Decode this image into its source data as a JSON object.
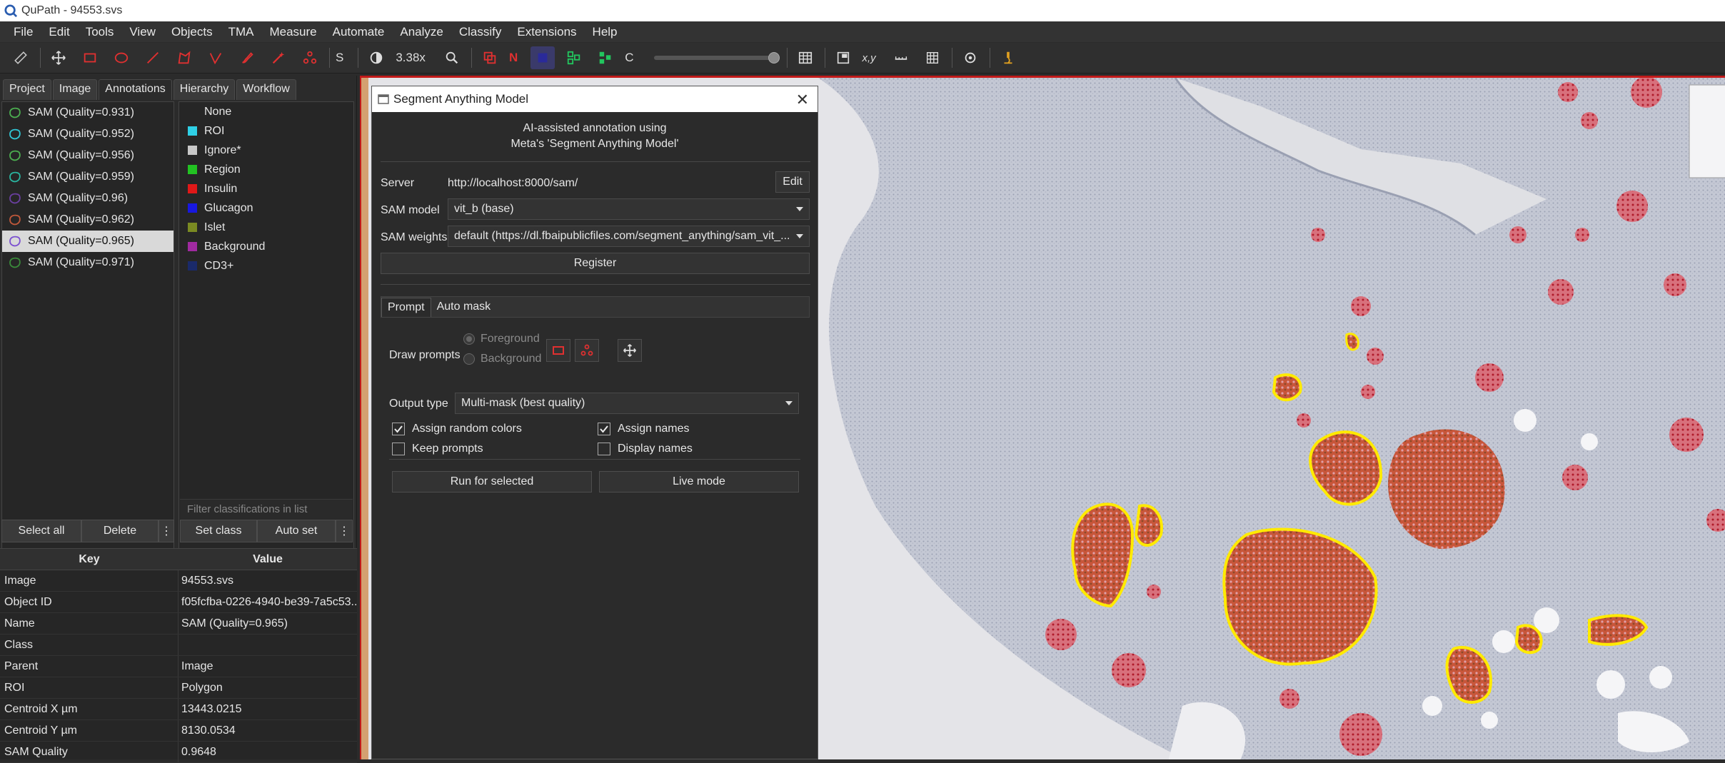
{
  "window": {
    "title": "QuPath - 94553.svs"
  },
  "menu": [
    "File",
    "Edit",
    "Tools",
    "View",
    "Objects",
    "TMA",
    "Measure",
    "Automate",
    "Analyze",
    "Classify",
    "Extensions",
    "Help"
  ],
  "toolbar": {
    "zoom": "3.38x",
    "s_label": "S",
    "n_label": "N",
    "c_label": "C",
    "xy_label": "x,y"
  },
  "left_tabs": [
    "Project",
    "Image",
    "Annotations",
    "Hierarchy",
    "Workflow"
  ],
  "annotations": [
    {
      "name": "SAM (Quality=0.931)",
      "color": "#4caf50"
    },
    {
      "name": "SAM (Quality=0.952)",
      "color": "#31c7d6"
    },
    {
      "name": "SAM (Quality=0.956)",
      "color": "#4caf50"
    },
    {
      "name": "SAM (Quality=0.959)",
      "color": "#2ab5a0"
    },
    {
      "name": "SAM (Quality=0.96)",
      "color": "#6a3fa0"
    },
    {
      "name": "SAM (Quality=0.962)",
      "color": "#c0583a"
    },
    {
      "name": "SAM (Quality=0.965)",
      "color": "#7a4fd0",
      "selected": true
    },
    {
      "name": "SAM (Quality=0.971)",
      "color": "#3a8a3a"
    }
  ],
  "classes": [
    {
      "name": "None",
      "color": ""
    },
    {
      "name": "ROI",
      "color": "#2fd0e6"
    },
    {
      "name": "Ignore*",
      "color": "#c8c8c8"
    },
    {
      "name": "Region",
      "color": "#22c222"
    },
    {
      "name": "Insulin",
      "color": "#e01818"
    },
    {
      "name": "Glucagon",
      "color": "#1818e0"
    },
    {
      "name": "Islet",
      "color": "#7a8a22"
    },
    {
      "name": "Background",
      "color": "#a02aa0"
    },
    {
      "name": "CD3+",
      "color": "#1a2a6a"
    }
  ],
  "class_filter_placeholder": "Filter classifications in list",
  "buttons": {
    "select_all": "Select all",
    "delete": "Delete",
    "set_class": "Set class",
    "auto_set": "Auto set",
    "more": "⋮"
  },
  "properties": {
    "headers": [
      "Key",
      "Value"
    ],
    "rows": [
      {
        "key": "Image",
        "value": "94553.svs"
      },
      {
        "key": "Object ID",
        "value": "f05fcfba-0226-4940-be39-7a5c53..."
      },
      {
        "key": "Name",
        "value": "SAM (Quality=0.965)"
      },
      {
        "key": "Class",
        "value": ""
      },
      {
        "key": "Parent",
        "value": "Image"
      },
      {
        "key": "ROI",
        "value": "Polygon"
      },
      {
        "key": "Centroid X µm",
        "value": "13443.0215"
      },
      {
        "key": "Centroid Y µm",
        "value": "8130.0534"
      },
      {
        "key": "SAM Quality",
        "value": "0.9648"
      }
    ]
  },
  "dialog": {
    "title": "Segment Anything Model",
    "intro_line1": "AI-assisted annotation using",
    "intro_line2": "Meta's 'Segment Anything Model'",
    "server_label": "Server",
    "server_value": "http://localhost:8000/sam/",
    "edit": "Edit",
    "model_label": "SAM model",
    "model_value": "vit_b (base)",
    "weights_label": "SAM weights",
    "weights_value": "default (https://dl.fbaipublicfiles.com/segment_anything/sam_vit_...",
    "register": "Register",
    "tabs": [
      "Prompt",
      "Auto mask"
    ],
    "draw_prompts": "Draw prompts",
    "foreground": "Foreground",
    "background": "Background",
    "output_type_label": "Output type",
    "output_type_value": "Multi-mask (best quality)",
    "assign_random_colors": "Assign random colors",
    "assign_names": "Assign names",
    "keep_prompts": "Keep prompts",
    "display_names": "Display names",
    "run_selected": "Run for selected",
    "live_mode": "Live mode",
    "checks": {
      "assign_random_colors": true,
      "assign_names": true,
      "keep_prompts": false,
      "display_names": false
    }
  }
}
